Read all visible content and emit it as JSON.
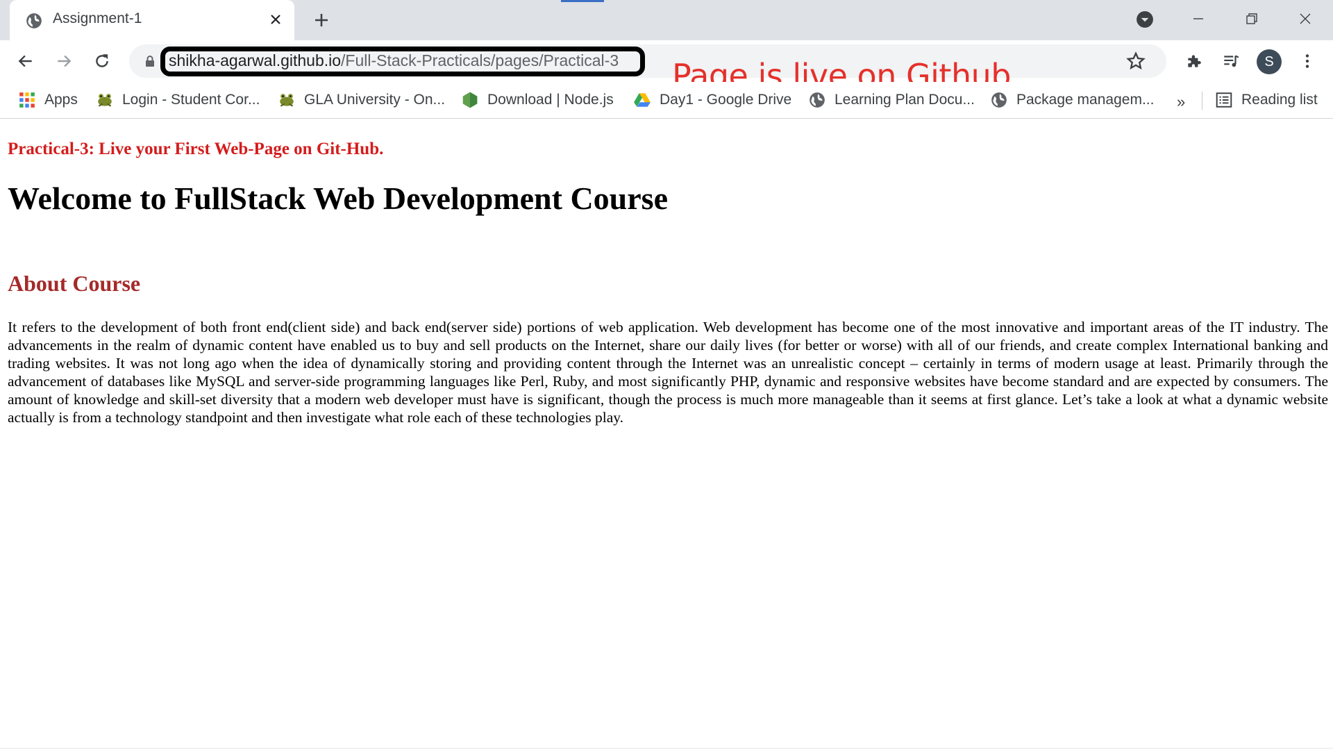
{
  "browser": {
    "tab": {
      "title": "Assignment-1"
    },
    "address_bar": {
      "url_host": "shikha-agarwal.github.io",
      "url_path": "/Full-Stack-Practicals/pages/Practical-3"
    },
    "annotation": "Page is live on Github",
    "profile_initial": "S",
    "bookmarks": [
      {
        "label": "Apps",
        "icon": "apps-grid-icon"
      },
      {
        "label": "Login - Student Cor...",
        "icon": "frog-icon"
      },
      {
        "label": "GLA University - On...",
        "icon": "frog-icon"
      },
      {
        "label": "Download | Node.js",
        "icon": "nodejs-icon"
      },
      {
        "label": "Day1 - Google Drive",
        "icon": "google-drive-icon"
      },
      {
        "label": "Learning Plan Docu...",
        "icon": "globe-icon"
      },
      {
        "label": "Package managem...",
        "icon": "globe-icon"
      }
    ],
    "bookmarks_more": "»",
    "reading_list": "Reading list"
  },
  "page": {
    "practical_title": "Practical-3: Live your First Web-Page on Git-Hub.",
    "welcome_heading": "Welcome to FullStack Web Development Course",
    "about_heading": "About Course",
    "about_text": "It refers to the development of both front end(client side) and back end(server side) portions of web application. Web development has become one of the most innovative and important areas of the IT industry. The advancements in the realm of dynamic content have enabled us to buy and sell products on the Internet, share our daily lives (for better or worse) with all of our friends, and create complex International banking and trading websites. It was not long ago when the idea of dynamically storing and providing content through the Internet was an unrealistic concept – certainly in terms of modern usage at least. Primarily through the advancement of databases like MySQL and server-side programming languages like Perl, Ruby, and most significantly PHP, dynamic and responsive websites have become standard and are expected by consumers. The amount of knowledge and skill-set diversity that a modern web developer must have is significant, though the process is much more manageable than it seems at first glance. Let’s take a look at what a dynamic website actually is from a technology standpoint and then investigate what role each of these technologies play."
  },
  "colors": {
    "practical_title": "#d41c1c",
    "about_heading": "#a52a2a",
    "annotation": "#e5302b",
    "tabstrip": "#dee1e6"
  }
}
